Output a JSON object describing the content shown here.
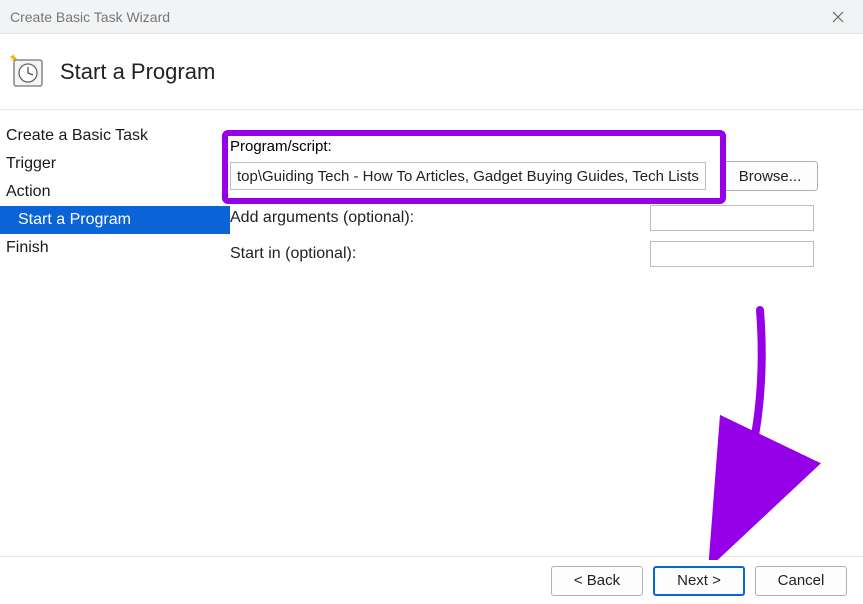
{
  "titlebar": {
    "title": "Create Basic Task Wizard"
  },
  "header": {
    "title": "Start a Program"
  },
  "sidebar": {
    "items": [
      {
        "label": "Create a Basic Task"
      },
      {
        "label": "Trigger"
      },
      {
        "label": "Action"
      },
      {
        "label": "Start a Program",
        "active": true,
        "indent": true
      },
      {
        "label": "Finish"
      }
    ]
  },
  "form": {
    "program_label": "Program/script:",
    "program_value": "top\\Guiding Tech - How To Articles, Gadget Buying Guides, Tech Lists.url\"",
    "browse_label": "Browse...",
    "args_label": "Add arguments (optional):",
    "args_value": "",
    "startin_label": "Start in (optional):",
    "startin_value": ""
  },
  "footer": {
    "back": "< Back",
    "next": "Next >",
    "cancel": "Cancel"
  }
}
